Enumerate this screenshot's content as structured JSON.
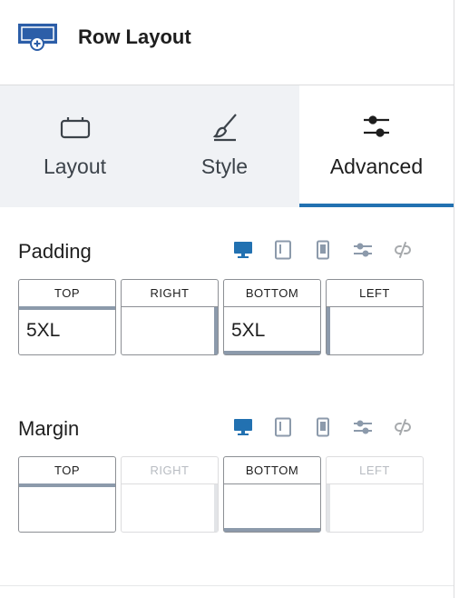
{
  "header": {
    "title": "Row Layout",
    "icon": "row-layout-icon"
  },
  "tabs": [
    {
      "label": "Layout",
      "icon": "layout-icon",
      "active": false
    },
    {
      "label": "Style",
      "icon": "brush-icon",
      "active": false
    },
    {
      "label": "Advanced",
      "icon": "sliders-icon",
      "active": true
    }
  ],
  "padding": {
    "label": "Padding",
    "boxes": [
      {
        "label": "TOP",
        "value": "5XL"
      },
      {
        "label": "RIGHT",
        "value": ""
      },
      {
        "label": "BOTTOM",
        "value": "5XL"
      },
      {
        "label": "LEFT",
        "value": ""
      }
    ]
  },
  "margin": {
    "label": "Margin",
    "boxes": [
      {
        "label": "TOP",
        "value": ""
      },
      {
        "label": "RIGHT",
        "value": ""
      },
      {
        "label": "BOTTOM",
        "value": ""
      },
      {
        "label": "LEFT",
        "value": ""
      }
    ]
  },
  "device_icons": [
    "desktop-icon",
    "tablet-icon",
    "mobile-icon",
    "custom-sliders-icon",
    "unlink-icon"
  ],
  "colors": {
    "accent": "#2271b1",
    "muted": "#8c9aab"
  }
}
